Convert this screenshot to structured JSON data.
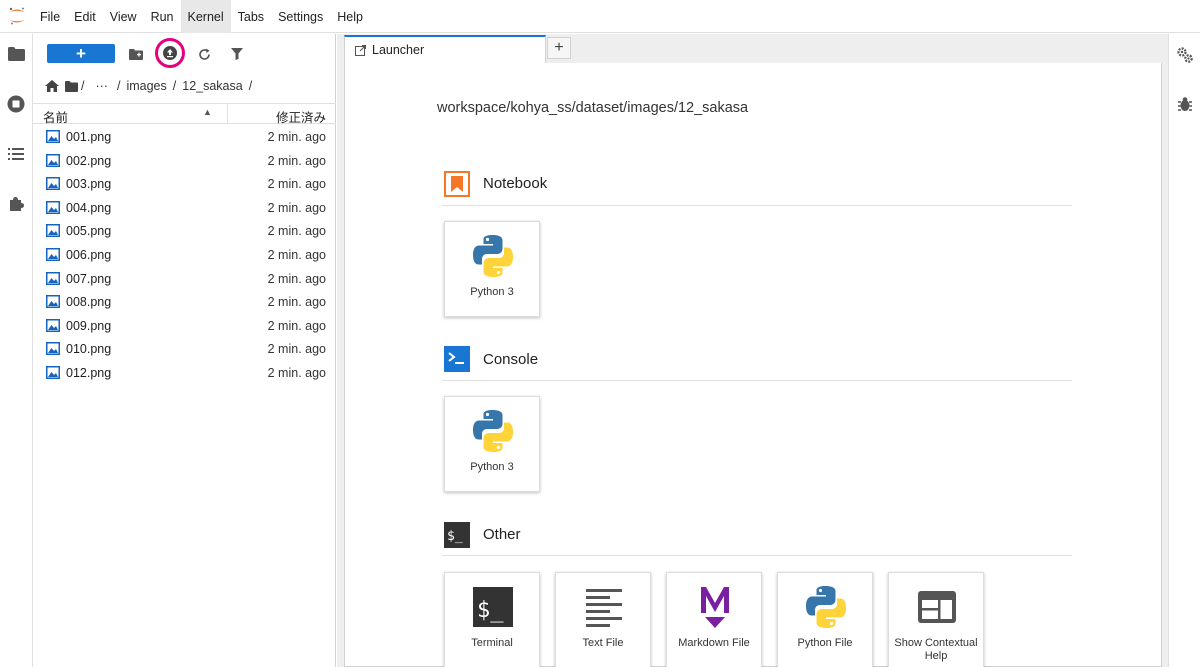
{
  "menu": [
    "File",
    "Edit",
    "View",
    "Run",
    "Kernel",
    "Tabs",
    "Settings",
    "Help"
  ],
  "active_menu": "Kernel",
  "toolbar": {
    "new_label": "+"
  },
  "breadcrumb": {
    "sep1": "/",
    "ellipsis": "···",
    "sep2": "/",
    "dir1": "images",
    "sep3": "/",
    "dir2": "12_sakasa",
    "sep4": "/"
  },
  "filelist": {
    "col_name": "名前",
    "col_modified": "修正済み",
    "files": [
      {
        "name": "001.png",
        "modified": "2 min. ago"
      },
      {
        "name": "002.png",
        "modified": "2 min. ago"
      },
      {
        "name": "003.png",
        "modified": "2 min. ago"
      },
      {
        "name": "004.png",
        "modified": "2 min. ago"
      },
      {
        "name": "005.png",
        "modified": "2 min. ago"
      },
      {
        "name": "006.png",
        "modified": "2 min. ago"
      },
      {
        "name": "007.png",
        "modified": "2 min. ago"
      },
      {
        "name": "008.png",
        "modified": "2 min. ago"
      },
      {
        "name": "009.png",
        "modified": "2 min. ago"
      },
      {
        "name": "010.png",
        "modified": "2 min. ago"
      },
      {
        "name": "012.png",
        "modified": "2 min. ago"
      }
    ]
  },
  "tabs": {
    "launcher": "Launcher",
    "add": "+"
  },
  "launcher": {
    "path": "workspace/kohya_ss/dataset/images/12_sakasa",
    "notebook_title": "Notebook",
    "notebook_card": "Python 3",
    "console_title": "Console",
    "console_card": "Python 3",
    "other_title": "Other",
    "other_cards": [
      "Terminal",
      "Text File",
      "Markdown File",
      "Python File",
      "Show Contextual Help"
    ]
  },
  "colors": {
    "accent": "#1976d2",
    "highlight_ring": "#e6007e",
    "notebook_icon": "#f37726"
  }
}
